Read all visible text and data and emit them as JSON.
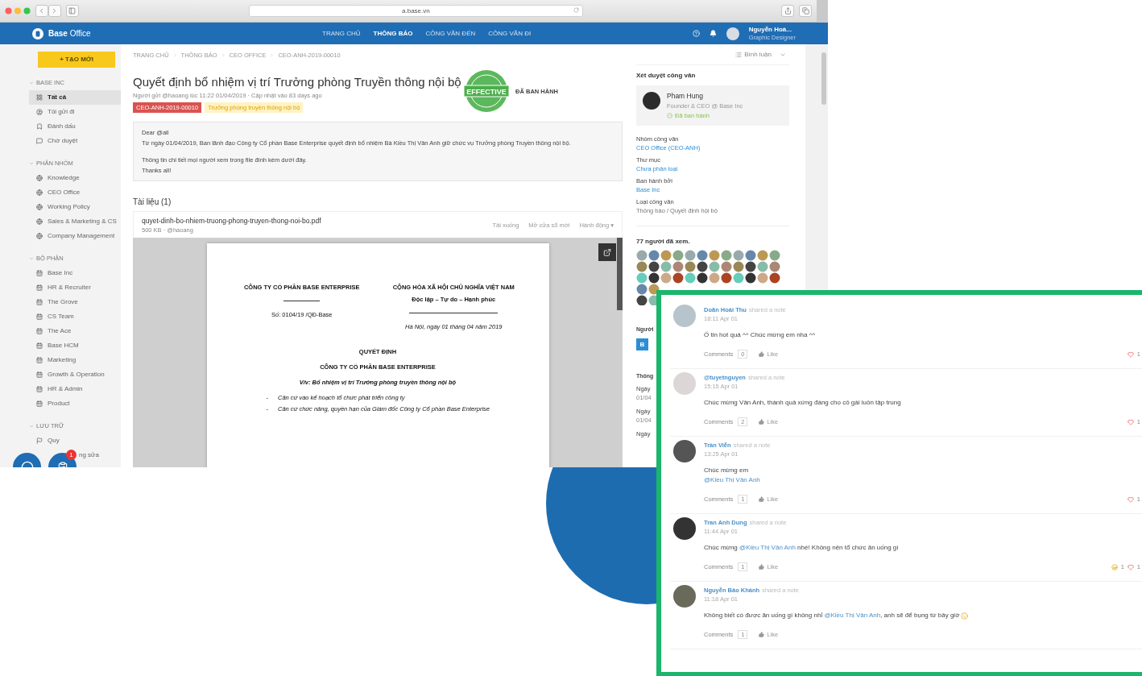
{
  "browser": {
    "url": "a.base.vn"
  },
  "app_bar": {
    "brand": "**Base** Office",
    "nav": [
      {
        "label": "TRANG CHỦ",
        "selected": false
      },
      {
        "label": "THÔNG BÁO",
        "selected": true
      },
      {
        "label": "CÔNG VĂN ĐẾN",
        "selected": false
      },
      {
        "label": "CÔNG VĂN ĐI",
        "selected": false
      }
    ],
    "user": {
      "name": "Nguyễn Hoà...",
      "role": "Graphic Designer"
    }
  },
  "sidebar": {
    "create_button": "+ TẠO MỚI",
    "sections": [
      {
        "title": "BASE INC",
        "items": [
          {
            "label": "Tất cả",
            "kind": "grid",
            "selected": true
          },
          {
            "label": "Tôi gửi đi",
            "kind": "user",
            "selected": false
          },
          {
            "label": "Đánh dấu",
            "kind": "bookmark",
            "selected": false
          },
          {
            "label": "Chờ duyệt",
            "kind": "chat",
            "selected": false
          }
        ]
      },
      {
        "title": "PHÂN NHÓM",
        "items": [
          {
            "label": "Knowledge",
            "kind": "globe",
            "selected": false
          },
          {
            "label": "CEO Office",
            "kind": "globe",
            "selected": false
          },
          {
            "label": "Working Policy",
            "kind": "globe",
            "selected": false
          },
          {
            "label": "Sales & Marketing & CS",
            "kind": "globe",
            "selected": false
          },
          {
            "label": "Company Management",
            "kind": "globe",
            "selected": false
          }
        ]
      },
      {
        "title": "BỘ PHẬN",
        "items": [
          {
            "label": "Base Inc",
            "kind": "calendar",
            "selected": false
          },
          {
            "label": "HR & Recruiter",
            "kind": "calendar",
            "selected": false
          },
          {
            "label": "The Grove",
            "kind": "calendar",
            "selected": false
          },
          {
            "label": "CS Team",
            "kind": "calendar",
            "selected": false
          },
          {
            "label": "The Ace",
            "kind": "calendar",
            "selected": false
          },
          {
            "label": "Base HCM",
            "kind": "calendar",
            "selected": false
          },
          {
            "label": "Marketing",
            "kind": "calendar",
            "selected": false
          },
          {
            "label": "Growth & Operation",
            "kind": "calendar",
            "selected": false
          },
          {
            "label": "HR & Admin",
            "kind": "calendar",
            "selected": false
          },
          {
            "label": "Product",
            "kind": "calendar",
            "selected": false
          }
        ]
      },
      {
        "title": "LƯU TRỮ",
        "items": [
          {
            "label": "Quy",
            "kind": "flag",
            "selected": false
          },
          {
            "label": "ng sửa",
            "kind": "clipped",
            "selected": false
          }
        ]
      }
    ],
    "chat_badge": "1"
  },
  "main": {
    "breadcrumb": [
      "TRANG CHỦ",
      "THÔNG BÁO",
      "CEO OFFICE",
      "CEO-ANH-2019-00010"
    ],
    "title": "Quyết định bổ nhiệm vị trí Trưởng phòng Truyền thông nội bộ",
    "meta": "Người gửi @haoang lúc 11:22 01/04/2019 · Cập nhật vào 83 days ago",
    "tags": [
      {
        "text": "CEO-ANH-2019-00010",
        "kind": "code"
      },
      {
        "text": "Trưởng phòng truyền thông nội bộ",
        "kind": "category"
      }
    ],
    "stamp": {
      "text": "EFFECTIVE",
      "status": "ĐÃ BAN HÀNH"
    },
    "message": [
      [
        "Dear @all",
        "Từ ngày 01/04/2019, Ban lãnh đạo Công ty Cổ phần Base Enterprise quyết định bổ nhiệm Bà Kiều Thị Vân Anh giữ chức vụ Trưởng phòng Truyền thông nội bộ."
      ],
      [
        "Thông tin chi tiết mọi người xem trong file đính kèm dưới đây.",
        "Thanks all!"
      ]
    ],
    "attachments_heading": "Tài liệu (1)",
    "file": {
      "name": "quyet-dinh-bo-nhiem-truong-phong-truyen-thong-noi-bo.pdf",
      "meta": "500 KB · @haoang",
      "actions": [
        "Tải xuống",
        "Mở cửa sổ mới",
        "Hành động ▾"
      ]
    },
    "document": {
      "company": "CÔNG TY CỔ PHẦN BASE ENTERPRISE",
      "number": "Số: 0104/19 /QĐ-Base",
      "nation": "CỘNG HÒA XÃ HỘI CHỦ NGHĨA VIỆT NAM",
      "motto": "Độc lập – Tự do – Hạnh phúc",
      "date": "Hà Nội, ngày 01 tháng 04 năm 2019",
      "title": "QUYẾT ĐỊNH",
      "issuer": "CÔNG TY CỔ PHẦN BASE ENTERPRISE",
      "subject": "V/v: Bổ nhiệm vị trí Trưởng phòng truyền thông nội bộ",
      "bullets": [
        {
          "marker": "-",
          "text": "Căn cứ vào kế hoạch tổ chức phát triển công ty"
        },
        {
          "marker": "-",
          "text": "Căn cứ chức năng, quyền hạn của Giám đốc Công ty Cổ phần Base Enterprise"
        }
      ]
    }
  },
  "right_panel": {
    "comments_toggle": "Bình luận",
    "approval_title": "Xét duyệt công văn",
    "approver": {
      "name": "Pham Hung",
      "role": "Founder & CEO @ Base Inc",
      "status": "Đã ban hành"
    },
    "fields": [
      {
        "label": "Nhóm công văn",
        "value": "CEO Office (CEO-ANH)",
        "link": true
      },
      {
        "label": "Thư mục",
        "value": "Chưa phân loại",
        "link": true
      },
      {
        "label": "Ban hành bởi",
        "value": "Base Inc",
        "link": true
      },
      {
        "label": "Loại công văn",
        "value": "Thông báo / Quyết định hội bộ",
        "link": false
      }
    ],
    "viewers_title": "77 người đã xem.",
    "covered": {
      "heading": "Người",
      "button": "B",
      "info_heading": "Thông",
      "rows": [
        {
          "label": "Ngày",
          "value": "01/04"
        },
        {
          "label": "Ngày",
          "value": "01/04"
        },
        {
          "label": "Ngày"
        }
      ]
    }
  },
  "comments": [
    {
      "author": "Doãn Hoài Thu",
      "action": "shared a note",
      "time": "18:11 Apr 01",
      "body": [
        [
          {
            "kind": "text",
            "text": "Ố tin hot quá ^^ Chúc mừng em nha ^^"
          }
        ]
      ],
      "comments_label": "Comments",
      "count": "0",
      "like": "Like",
      "reactions": [
        {
          "kind": "heart",
          "count": "1"
        }
      ]
    },
    {
      "author": "@tuyetnguyen",
      "action": "shared a note",
      "time": "15:15 Apr 01",
      "body": [
        [
          {
            "kind": "text",
            "text": "Chúc mừng Vân Anh, thành quả xứng đáng cho cô gái luôn tập trung"
          }
        ]
      ],
      "comments_label": "Comments",
      "count": "2",
      "like": "Like",
      "reactions": [
        {
          "kind": "heart",
          "count": "1"
        }
      ]
    },
    {
      "author": "Trần Viễn",
      "action": "shared a note",
      "time": "13:25 Apr 01",
      "body": [
        [
          {
            "kind": "text",
            "text": "Chúc mừng em"
          }
        ],
        [
          {
            "kind": "mention",
            "text": "@Kiều Thị Vân Anh"
          }
        ]
      ],
      "comments_label": "Comments",
      "count": "1",
      "like": "Like",
      "reactions": [
        {
          "kind": "heart",
          "count": "1"
        }
      ]
    },
    {
      "author": "Tran Anh Dung",
      "action": "shared a note",
      "time": "11:44 Apr 01",
      "body": [
        [
          {
            "kind": "text",
            "text": "Chúc mừng "
          },
          {
            "kind": "mention",
            "text": "@Kiều Thị Vân Anh"
          },
          {
            "kind": "text",
            "text": " nhé! Không nên tổ chức ăn uống gì"
          }
        ]
      ],
      "comments_label": "Comments",
      "count": "1",
      "like": "Like",
      "reactions": [
        {
          "kind": "laugh",
          "count": "1"
        },
        {
          "kind": "heart",
          "count": "1"
        }
      ]
    },
    {
      "author": "Nguyễn Bảo Khánh",
      "action": "shared a note",
      "time": "11:18 Apr 01",
      "body": [
        [
          {
            "kind": "text",
            "text": "Không biết có được ăn uống gì không nhỉ "
          },
          {
            "kind": "mention",
            "text": "@Kiều Thị Vân Anh"
          },
          {
            "kind": "text",
            "text": ", anh sẽ để bụng từ bây giờ"
          },
          {
            "kind": "emoji"
          }
        ]
      ],
      "comments_label": "Comments",
      "count": "1",
      "like": "Like"
    }
  ]
}
